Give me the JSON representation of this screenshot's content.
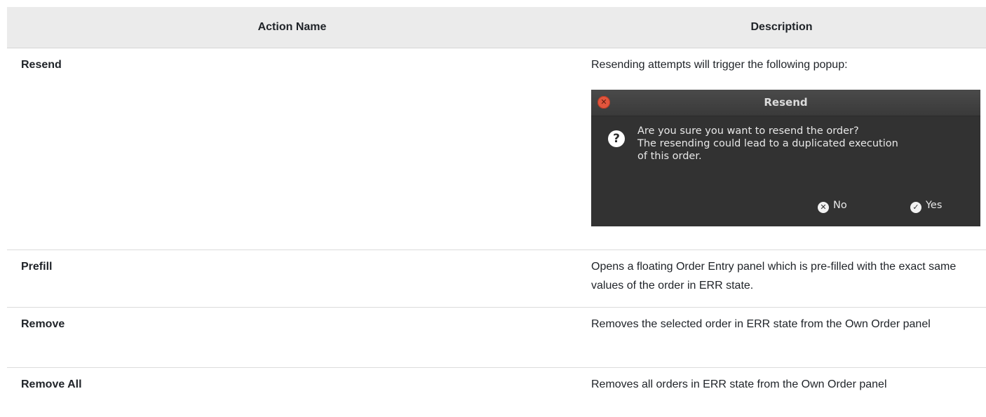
{
  "table": {
    "headers": [
      "Action Name",
      "Description"
    ],
    "rows": [
      {
        "name": "Resend",
        "description": "Resending attempts will trigger the following popup:"
      },
      {
        "name": "Prefill",
        "description": "Opens a floating Order Entry panel which is pre-filled with the exact same values of the order in ERR state."
      },
      {
        "name": "Remove",
        "description": "Removes the selected order in ERR state from the Own Order panel"
      },
      {
        "name": "Remove All",
        "description": "Removes all orders in ERR state from the Own Order panel"
      }
    ]
  },
  "dialog": {
    "title": "Resend",
    "close_icon": "close-icon",
    "question_icon": "question-icon",
    "message": "Are you sure you want to resend the order?\nThe resending could lead to a duplicated execution\nof this order.",
    "no_label": "No",
    "yes_label": "Yes",
    "colors": {
      "background": "#323232",
      "close": "#e2553d"
    }
  }
}
